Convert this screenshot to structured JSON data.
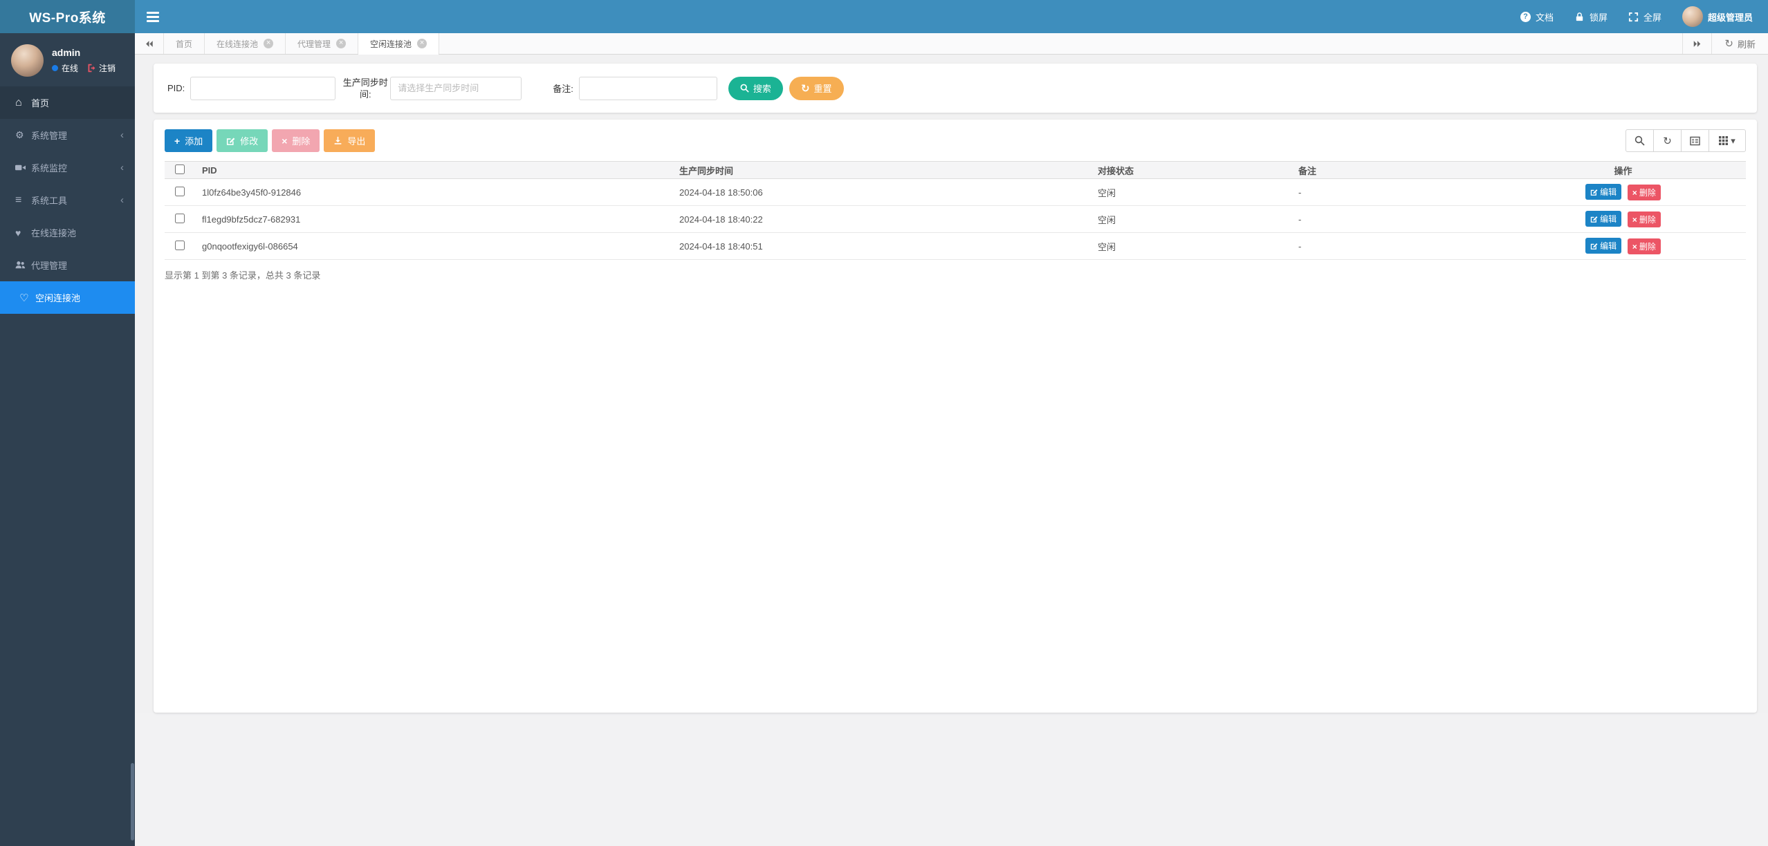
{
  "colors": {
    "brand_bg": "#34789C",
    "navbar_bg": "#3E8EBD",
    "sidebar_bg": "#2F4050",
    "sidebar_active": "#1E8CF0",
    "search_green": "#1BB394",
    "reset_orange": "#F6AE53",
    "add_blue": "#1C84C6",
    "edit_mint": "#76D7B9",
    "delete_pink": "#F2A6B0",
    "export_orange": "#F8AC59",
    "row_delete_red": "#EC5565",
    "online_dot": "#1A7CE8"
  },
  "icons": {
    "home": "⌂",
    "gear": "⚙",
    "bars": "≡",
    "heart": "♥",
    "heart_outline": "♡",
    "chevron_left": "‹",
    "refresh": "↻",
    "caret_down": "▾",
    "close": "×",
    "plus": "+",
    "question": "?",
    "times": "×"
  },
  "navbar": {
    "brand": "WS-Pro系统",
    "docs": "文档",
    "lock_screen": "锁屏",
    "fullscreen": "全屏",
    "username": "超级管理员"
  },
  "sidebar": {
    "user": {
      "name": "admin",
      "status": "在线",
      "logout": "注销"
    },
    "items": [
      {
        "label": "首页"
      },
      {
        "label": "系统管理"
      },
      {
        "label": "系统监控"
      },
      {
        "label": "系统工具"
      },
      {
        "label": "在线连接池"
      },
      {
        "label": "代理管理"
      },
      {
        "label": "空闲连接池"
      }
    ]
  },
  "tabbar": {
    "tabs": [
      {
        "label": "首页"
      },
      {
        "label": "在线连接池"
      },
      {
        "label": "代理管理"
      },
      {
        "label": "空闲连接池"
      }
    ],
    "refresh_label": "刷新"
  },
  "search_form": {
    "pid_label": "PID:",
    "sync_time_label": "生产同步时间:",
    "sync_time_placeholder": "请选择生产同步时间",
    "note_label": "备注:",
    "search_label": "搜索",
    "reset_label": "重置"
  },
  "toolbar": {
    "add_label": "添加",
    "edit_label": "修改",
    "delete_label": "删除",
    "export_label": "导出"
  },
  "table": {
    "headers": [
      "PID",
      "生产同步时间",
      "对接状态",
      "备注",
      "操作"
    ],
    "rows": [
      {
        "pid": "1l0fz64be3y45f0-912846",
        "sync_time": "2024-04-18 18:50:06",
        "status": "空闲",
        "note": "-"
      },
      {
        "pid": "fl1egd9bfz5dcz7-682931",
        "sync_time": "2024-04-18 18:40:22",
        "status": "空闲",
        "note": "-"
      },
      {
        "pid": "g0nqootfexigy6l-086654",
        "sync_time": "2024-04-18 18:40:51",
        "status": "空闲",
        "note": "-"
      }
    ],
    "row_edit_label": "编辑",
    "row_delete_label": "删除"
  },
  "summary": "显示第 1 到第 3 条记录，总共 3 条记录"
}
